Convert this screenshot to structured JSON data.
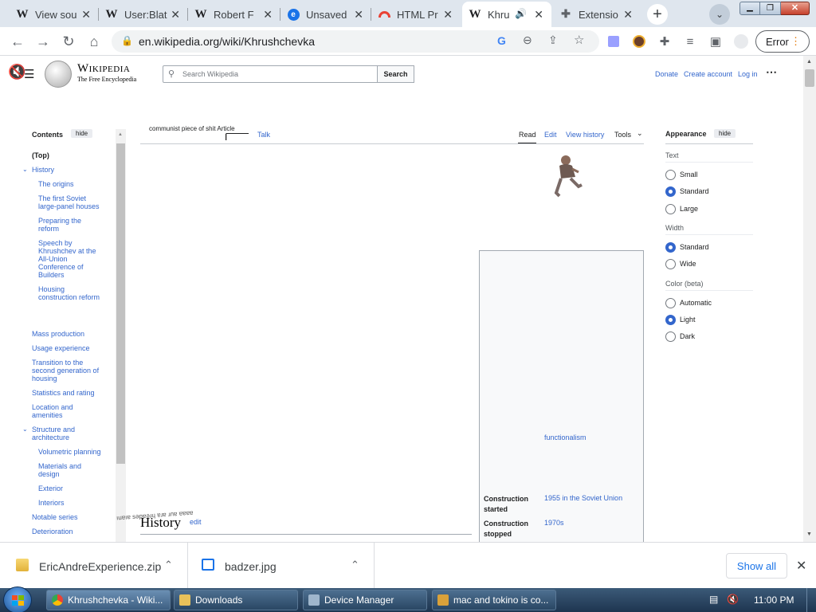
{
  "browser": {
    "tabs": [
      {
        "title": "View sou",
        "favicon": "wikipedia-w"
      },
      {
        "title": "User:Blat",
        "favicon": "wikipedia-w"
      },
      {
        "title": "Robert F",
        "favicon": "wikipedia-w"
      },
      {
        "title": "Unsaved",
        "favicon": "blue-e"
      },
      {
        "title": "HTML Pr",
        "favicon": "rainbow"
      },
      {
        "title": "Khru",
        "favicon": "wikipedia-w"
      },
      {
        "title": "Extensio",
        "favicon": "puzzle"
      }
    ],
    "url": "en.wikipedia.org/wiki/Khrushchevka",
    "error_label": "Error",
    "colors": {
      "tabbar": "#dfe6ee",
      "accent": "#1a73e8"
    }
  },
  "wiki": {
    "logo_title": "Wikipedia",
    "logo_tagline": "The Free Encyclopedia",
    "search_placeholder": "Search Wikipedia",
    "search_button": "Search",
    "header_links": {
      "donate": "Donate",
      "create_account": "Create account",
      "login": "Log in"
    },
    "article_tab": "communist piece of shit Article",
    "talk_tab": "Talk",
    "view_tabs": {
      "read": "Read",
      "edit": "Edit",
      "history": "View history",
      "tools": "Tools"
    },
    "contents_title": "Contents",
    "hide_label": "hide",
    "toc": [
      {
        "label": "(Top)",
        "level": 0
      },
      {
        "label": "History",
        "level": 0,
        "toggle": true
      },
      {
        "label": "The origins",
        "level": 1
      },
      {
        "label": "The first Soviet large-panel houses",
        "level": 1
      },
      {
        "label": "Preparing the reform",
        "level": 1
      },
      {
        "label": "Speech by Khrushchev at the All-Union Conference of Builders",
        "level": 1
      },
      {
        "label": "Housing construction reform",
        "level": 1
      },
      {
        "label": "Mass production",
        "level": 0
      },
      {
        "label": "Usage experience",
        "level": 0
      },
      {
        "label": "Transition to the second generation of housing",
        "level": 0
      },
      {
        "label": "Statistics and rating",
        "level": 0
      },
      {
        "label": "Location and amenities",
        "level": 0
      },
      {
        "label": "Structure and architecture",
        "level": 0,
        "toggle": true
      },
      {
        "label": "Volumetric planning",
        "level": 1
      },
      {
        "label": "Materials and design",
        "level": 1
      },
      {
        "label": "Exterior",
        "level": 1
      },
      {
        "label": "Interiors",
        "level": 1
      },
      {
        "label": "Notable series",
        "level": 0
      },
      {
        "label": "Deterioration",
        "level": 0
      }
    ],
    "appearance": {
      "title": "Appearance",
      "hide": "hide",
      "text_title": "Text",
      "text_options": [
        "Small",
        "Standard",
        "Large"
      ],
      "text_selected": "Standard",
      "width_title": "Width",
      "width_options": [
        "Standard",
        "Wide"
      ],
      "width_selected": "Standard",
      "color_title": "Color (beta)",
      "color_options": [
        "Automatic",
        "Light",
        "Dark"
      ],
      "color_selected": "Light"
    },
    "infobox": {
      "style_link": "functionalism",
      "rows": [
        {
          "label": "Construction started",
          "value": "1955 in the Soviet Union"
        },
        {
          "label": "Construction stopped",
          "value": "1970s"
        }
      ]
    },
    "section_heading": "History",
    "section_edit": "edit",
    "overlay_text": "ıuɐıɐ sǝpɐǝɹɥ ɐɹɐ ɹnɐ ɐɐɐɐ"
  },
  "downloads": {
    "items": [
      {
        "name": "EricAndreExperience.zip",
        "icon": "zip-folder-icon"
      },
      {
        "name": "badzer.jpg",
        "icon": "image-file-icon"
      }
    ],
    "show_all": "Show all"
  },
  "taskbar": {
    "items": [
      {
        "label": "Khrushchevka - Wiki...",
        "icon": "chrome-icon"
      },
      {
        "label": "Downloads",
        "icon": "folder-icon"
      },
      {
        "label": "Device Manager",
        "icon": "device-manager-icon"
      },
      {
        "label": "mac and tokino is co...",
        "icon": "chat-icon"
      }
    ],
    "clock": "11:00 PM"
  }
}
